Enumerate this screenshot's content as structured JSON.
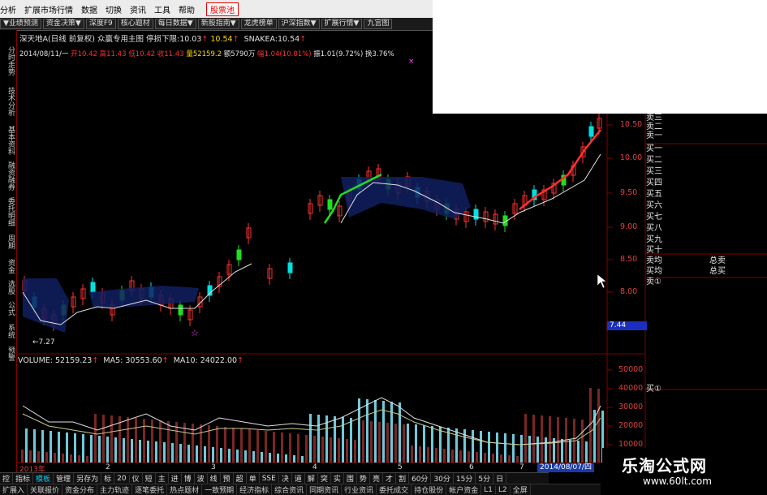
{
  "menubar": {
    "items": [
      "分析",
      "扩展市场行情",
      "数据",
      "切换",
      "资讯",
      "工具",
      "帮助"
    ],
    "highlight": "股票池"
  },
  "toolbar": {
    "items": [
      "▼业绩预测",
      "资金决策▼",
      "深度F9",
      "核心题材",
      "每日数据▼",
      "新股指南▼",
      "龙虎榜单",
      "沪深指数▼",
      "扩展行情▼",
      "九宫图"
    ]
  },
  "left_tabs": [
    "分时走势",
    "技术分析",
    "基本资料",
    "融资融券",
    "委托明细",
    "周期",
    "资金",
    "选股",
    "公式",
    "系统",
    "预警"
  ],
  "chart_header": {
    "title": "深天地A(日线 前复权) 众赢专用主图",
    "stop_label": "停损下限:",
    "stop_value": "10.03",
    "stop_value2": "10.54",
    "snake_label": "SNAKEA:",
    "snake_value": "10.54"
  },
  "quote_line": {
    "date": "2014/08/11/一",
    "open_label": "开",
    "open": "10.42",
    "high_label": "高",
    "high": "11.43",
    "low_label": "低",
    "low": "10.42",
    "close_label": "收",
    "close": "11.43",
    "vol_label": "量",
    "vol": "52159.2",
    "amt_label": "额",
    "amt": "5790万",
    "chg_label": "幅",
    "chg": "1.04(10.01%)",
    "amp_label": "振",
    "amp": "1.01(9.72%)",
    "turn_label": "换",
    "turn": "3.76%"
  },
  "price_axis": [
    "10.50",
    "10.00",
    "9.50",
    "9.00",
    "8.50",
    "8.00"
  ],
  "price_tag": "7.44",
  "low_marker": "←7.27",
  "volume_line": {
    "vol_label": "VOLUME:",
    "vol": "52159.23",
    "ma5_label": "MA5:",
    "ma5": "30553.60",
    "ma10_label": "MA10:",
    "ma10": "24022.00"
  },
  "volume_axis": [
    "50000",
    "40000",
    "30000",
    "20000",
    "10000"
  ],
  "right_panel": {
    "rows": [
      "卖三",
      "卖二",
      "卖一",
      "买一",
      "买二",
      "买三",
      "买四",
      "买五",
      "买六",
      "买七",
      "买八",
      "买九",
      "买十",
      "卖均",
      "买均",
      "卖①"
    ],
    "sell_total_label": "总卖",
    "buy_total_label": "总买",
    "buy_marker": "买①"
  },
  "x_axis": {
    "year": "2013年",
    "months": [
      "2",
      "3",
      "4",
      "5",
      "6",
      "7"
    ],
    "cursor_date": "2014/08/07/四"
  },
  "bottom_tabs1": [
    "控",
    "指标",
    "模板",
    "管理",
    "另存为",
    "标",
    "20",
    "仪",
    "短",
    "主",
    "进",
    "博",
    "波",
    "线",
    "预",
    "超",
    "单",
    "SSE",
    "决",
    "道",
    "解",
    "突",
    "实",
    "围",
    "势",
    "亮",
    "才",
    "割",
    "60分",
    "30分",
    "15分",
    "5分",
    "日"
  ],
  "bottom_tabs2": [
    "扩展入",
    "关联报价",
    "资金分布",
    "主力轨迹",
    "逐笔委托",
    "热点题材",
    "一致预期",
    "经济指标",
    "综合资讯",
    "同期资讯",
    "行业资讯",
    "委托成交",
    "持仓股份",
    "帐户资金",
    "L1",
    "L2",
    "全屏"
  ],
  "watermark": {
    "title": "乐淘公式网",
    "url": "www.60lt.com"
  },
  "colors": {
    "up": "#ff3030",
    "down": "#22dd22",
    "cyan": "#00e0e0",
    "grid": "#800000",
    "label": "#e8e8e8"
  }
}
